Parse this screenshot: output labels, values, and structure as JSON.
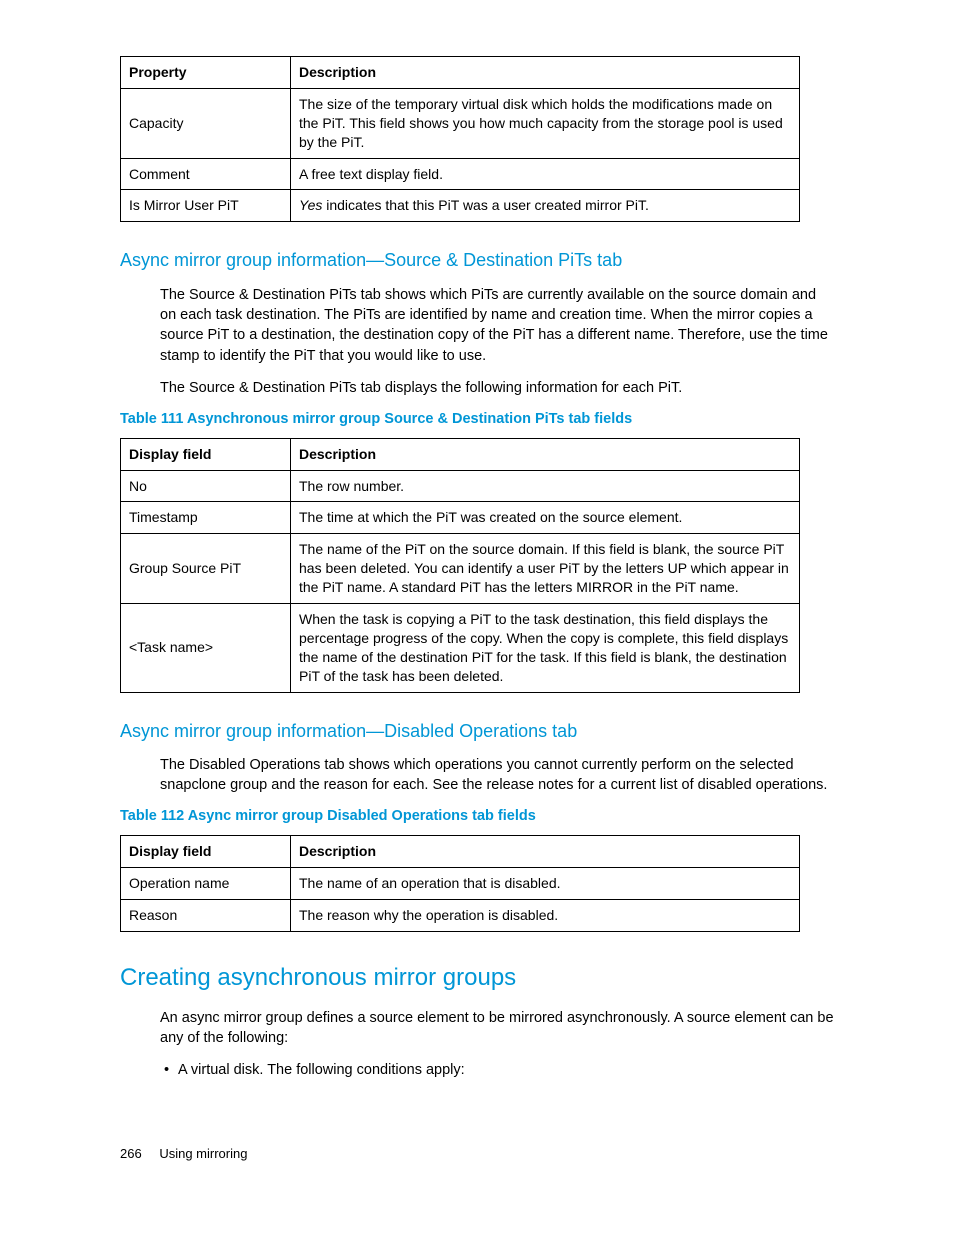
{
  "table0": {
    "h1": "Property",
    "h2": "Description",
    "rows": [
      {
        "p": "Capacity",
        "d": "The size of the temporary virtual disk which holds the modifications made on the PiT. This field shows you how much capacity from the storage pool is used by the PiT."
      },
      {
        "p": "Comment",
        "d": "A free text display field."
      },
      {
        "p": "Is Mirror User PiT",
        "d_pre": "Yes",
        "d_post": " indicates that this PiT was a user created mirror PiT."
      }
    ]
  },
  "sec1": {
    "heading": "Async mirror group information—Source & Destination PiTs tab",
    "para1": "The Source & Destination PiTs tab shows which PiTs are currently available on the source domain and on each task destination. The PiTs are identified by name and creation time. When the mirror copies a source PiT to a destination, the destination copy of the PiT has a different name. Therefore, use the time stamp to identify the PiT that you would like to use.",
    "para2": "The Source & Destination PiTs tab displays the following information for each PiT.",
    "caption": "Table 111 Asynchronous mirror group Source & Destination PiTs tab fields"
  },
  "table1": {
    "h1": "Display field",
    "h2": "Description",
    "rows": [
      {
        "p": "No",
        "d": "The row number."
      },
      {
        "p": "Timestamp",
        "d": "The time at which the PiT was created on the source element."
      },
      {
        "p": "Group Source PiT",
        "d": "The name of the PiT on the source domain. If this field is blank, the source PiT has been deleted. You can identify a user PiT by the letters UP which appear in the PiT name. A standard PiT has the letters MIRROR in the PiT name."
      },
      {
        "p": "<Task name>",
        "d": "When the task is copying a PiT to the task destination, this field displays the percentage progress of the copy. When the copy is complete, this field displays the name of the destination PiT for the task. If this field is blank, the destination PiT of the task has been deleted."
      }
    ]
  },
  "sec2": {
    "heading": "Async mirror group information—Disabled Operations tab",
    "para1": "The Disabled Operations tab shows which operations you cannot currently perform on the selected snapclone group and the reason for each. See the release notes for a current list of disabled operations.",
    "caption": "Table 112 Async mirror group Disabled Operations tab fields"
  },
  "table2": {
    "h1": "Display field",
    "h2": "Description",
    "rows": [
      {
        "p": "Operation name",
        "d": "The name of an operation that is disabled."
      },
      {
        "p": "Reason",
        "d": "The reason why the operation is disabled."
      }
    ]
  },
  "sec3": {
    "heading": "Creating asynchronous mirror groups",
    "para1": "An async mirror group defines a source element to be mirrored asynchronously. A source element can be any of the following:",
    "bullet1": "A virtual disk. The following conditions apply:"
  },
  "footer": {
    "page": "266",
    "title": "Using mirroring"
  }
}
